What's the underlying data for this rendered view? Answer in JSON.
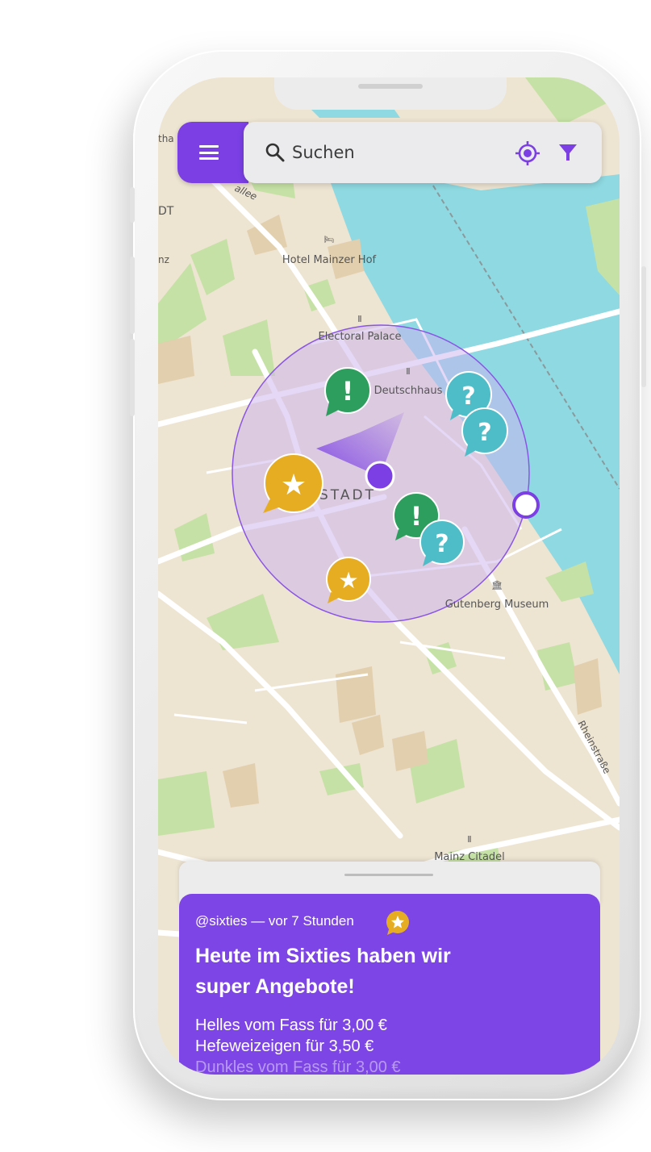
{
  "search": {
    "placeholder": "Suchen",
    "menu_icon": "menu-icon",
    "search_icon": "search-icon",
    "location_icon": "my-location-icon",
    "filter_icon": "filter-icon"
  },
  "colors": {
    "accent": "#7b3fe4",
    "water": "#8fd9e2",
    "park": "#c5e1a5",
    "land": "#eee4d2",
    "radius_fill": "#c9b1ee",
    "marker_green": "#2e9e5f",
    "marker_teal": "#4fbdc7",
    "marker_yellow": "#e6ad23"
  },
  "map": {
    "labels": {
      "hotel": "Hotel Mainzer Hof",
      "palace": "Electoral Palace",
      "deutschhaus": "Deutschhaus",
      "altstadt": "STADT",
      "museum": "Gutenberg Museum",
      "citadel": "Mainz Citadel",
      "rheinstrasse": "Rheinstraße",
      "allee": "allee",
      "edge_tha": "tha",
      "edge_dt": "DT",
      "edge_nz": "nz"
    },
    "markers": [
      {
        "type": "alert",
        "symbol": "!",
        "color": "green"
      },
      {
        "type": "question",
        "symbol": "?",
        "color": "teal"
      },
      {
        "type": "question",
        "symbol": "?",
        "color": "teal"
      },
      {
        "type": "star",
        "symbol": "★",
        "color": "yellow"
      },
      {
        "type": "alert",
        "symbol": "!",
        "color": "green"
      },
      {
        "type": "question",
        "symbol": "?",
        "color": "teal"
      },
      {
        "type": "star",
        "symbol": "★",
        "color": "yellow"
      }
    ]
  },
  "post": {
    "meta": "@sixties — vor 7 Stunden",
    "badge_icon": "star-badge-icon",
    "title": "Heute im Sixties haben wir super Angebote!",
    "lines": [
      "Helles vom Fass für 3,00 €",
      "Hefeweizeigen für 3,50 €",
      "Dunkles vom Fass für 3,00 €"
    ]
  }
}
